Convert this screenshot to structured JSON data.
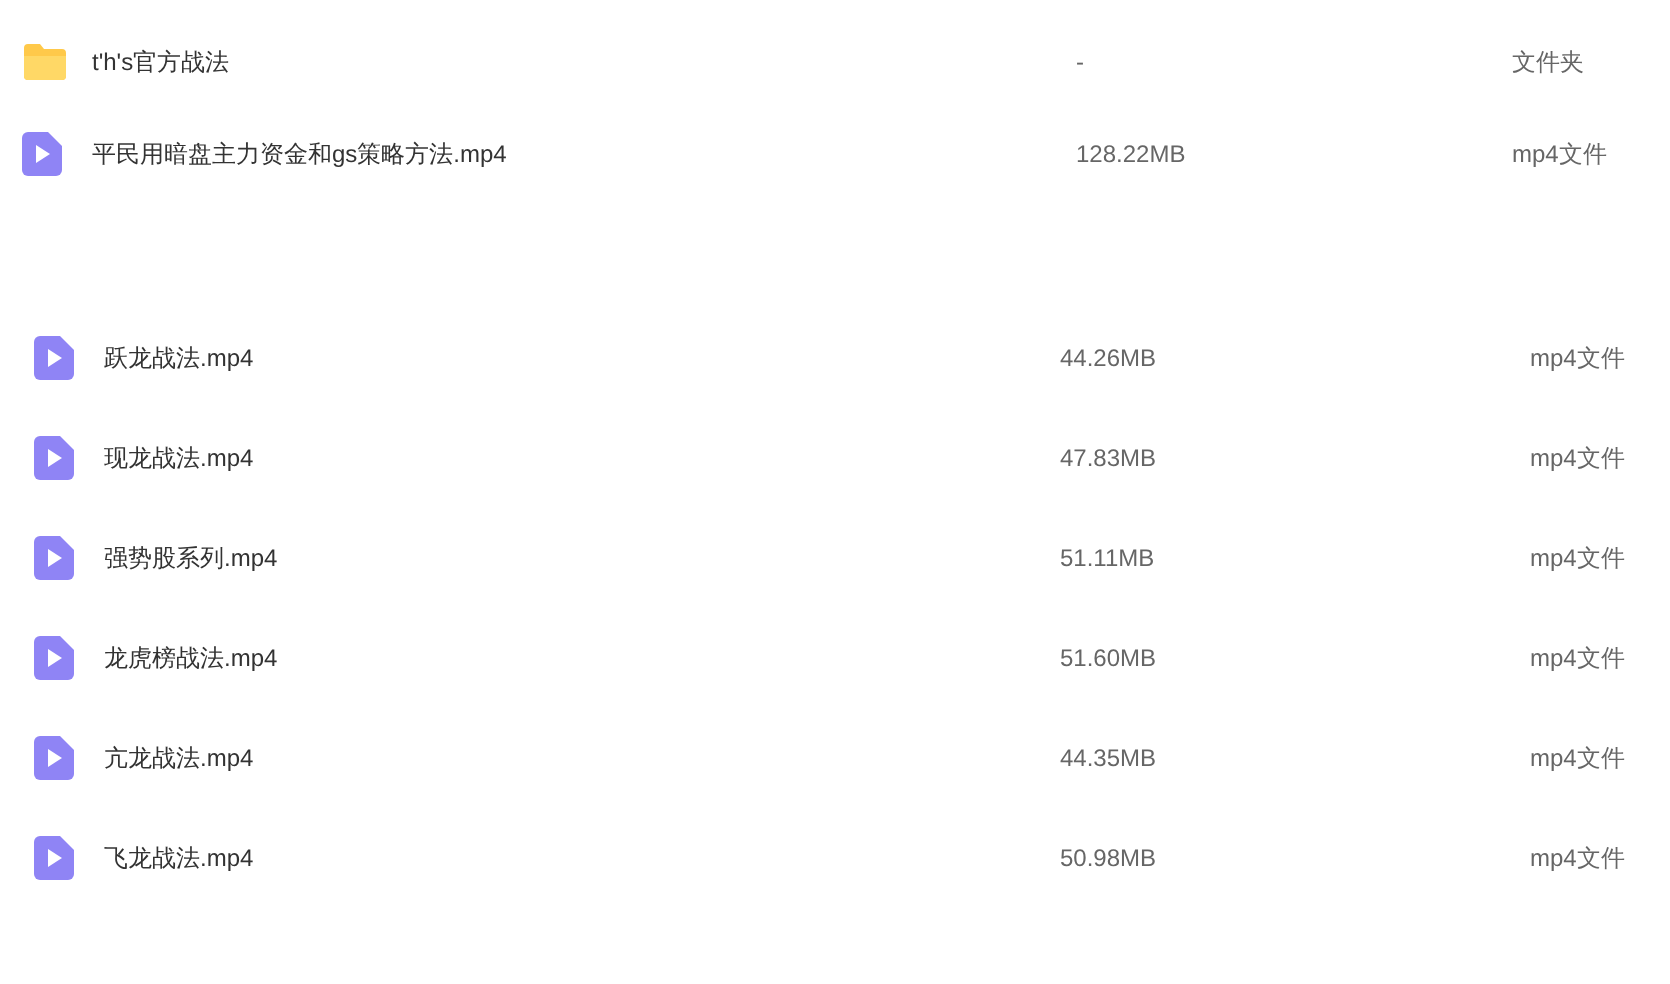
{
  "upper_list": [
    {
      "kind": "folder",
      "name": "t'h's官方战法",
      "size": "-",
      "type": "文件夹"
    },
    {
      "kind": "video",
      "name": "平民用暗盘主力资金和gs策略方法.mp4",
      "size": "128.22MB",
      "type": "mp4文件"
    }
  ],
  "lower_list": [
    {
      "kind": "video",
      "name": "跃龙战法.mp4",
      "size": "44.26MB",
      "type": "mp4文件"
    },
    {
      "kind": "video",
      "name": "现龙战法.mp4",
      "size": "47.83MB",
      "type": "mp4文件"
    },
    {
      "kind": "video",
      "name": "强势股系列.mp4",
      "size": "51.11MB",
      "type": "mp4文件"
    },
    {
      "kind": "video",
      "name": "龙虎榜战法.mp4",
      "size": "51.60MB",
      "type": "mp4文件"
    },
    {
      "kind": "video",
      "name": "亢龙战法.mp4",
      "size": "44.35MB",
      "type": "mp4文件"
    },
    {
      "kind": "video",
      "name": "飞龙战法.mp4",
      "size": "50.98MB",
      "type": "mp4文件"
    }
  ]
}
